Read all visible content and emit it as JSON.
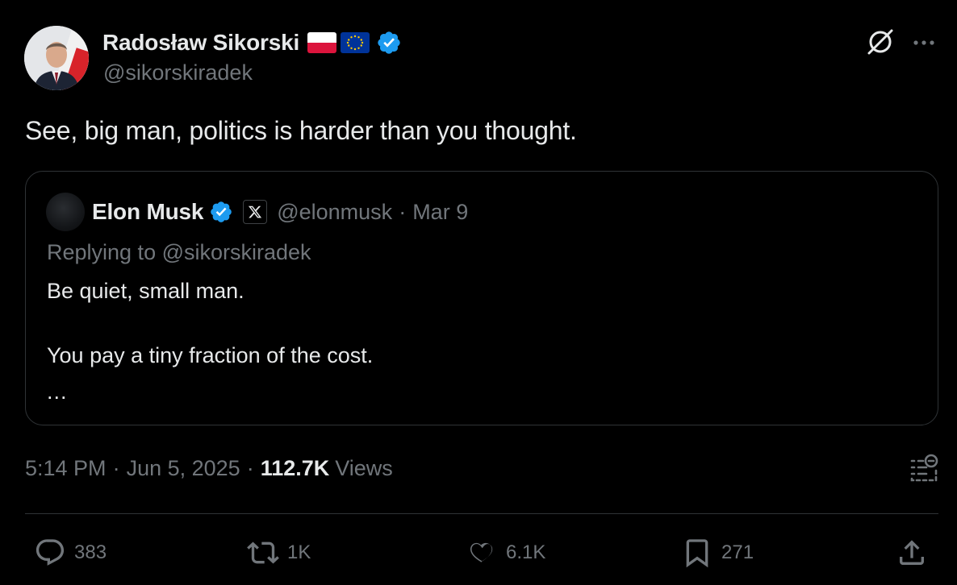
{
  "author": {
    "name": "Radosław Sikorski",
    "handle": "@sikorskiradek"
  },
  "tweet": {
    "text": "See, big man, politics is harder than you thought."
  },
  "quoted": {
    "name": "Elon Musk",
    "handle": "@elonmusk",
    "separator": "·",
    "date": "Mar 9",
    "replying_to": "Replying to @sikorskiradek",
    "line1": "Be quiet, small man.",
    "line2": "You pay a tiny fraction of the cost.",
    "ellipsis": "..."
  },
  "meta": {
    "time": "5:14 PM",
    "dot": "·",
    "date": "Jun 5, 2025",
    "views_count": "112.7K",
    "views_label": "Views"
  },
  "actions": {
    "replies": "383",
    "reposts": "1K",
    "likes": "6.1K",
    "bookmarks": "271"
  },
  "icons": {
    "verified": "verified-badge-icon",
    "flag_pl": "poland-flag-icon",
    "flag_eu": "eu-flag-icon",
    "grok": "grok-icon",
    "more": "more-icon",
    "affiliate": "x-logo-icon",
    "notes": "community-notes-icon",
    "reply": "reply-icon",
    "retweet": "retweet-icon",
    "like": "heart-icon",
    "bookmark": "bookmark-icon",
    "share": "share-icon"
  },
  "colors": {
    "background": "#000000",
    "text": "#e7e9ea",
    "muted": "#71767b",
    "border": "#2f3336",
    "verified": "#1d9bf0"
  }
}
